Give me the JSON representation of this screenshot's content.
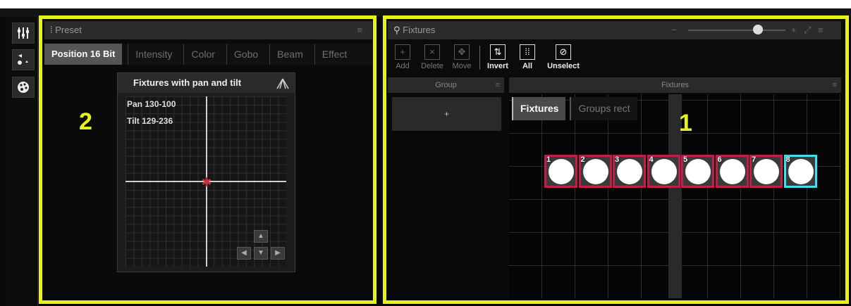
{
  "preset_panel": {
    "title": "Preset",
    "tabs": [
      "Position 16 Bit",
      "Intensity",
      "Color",
      "Gobo",
      "Beam",
      "Effect"
    ],
    "pan_tilt_box": {
      "title": "Fixtures with pan and tilt",
      "pan": "Pan 130-100",
      "tilt": "Tilt 129-236"
    },
    "callout_number": "2"
  },
  "fixtures_panel": {
    "title": "Fixtures",
    "toolbar": [
      {
        "label": "Add",
        "icon": "plus-icon"
      },
      {
        "label": "Delete",
        "icon": "x-icon"
      },
      {
        "label": "Move",
        "icon": "move-icon"
      },
      {
        "label": "Invert",
        "icon": "invert-icon"
      },
      {
        "label": "All",
        "icon": "select-all-icon"
      },
      {
        "label": "Unselect",
        "icon": "unselect-icon"
      }
    ],
    "group_header": "Group",
    "group_add": "+",
    "fixtures_header": "Fixtures",
    "view_tabs": [
      "Fixtures",
      "Groups rect"
    ],
    "fixtures": [
      {
        "num": "1",
        "selected": false
      },
      {
        "num": "2",
        "selected": false
      },
      {
        "num": "3",
        "selected": false
      },
      {
        "num": "4",
        "selected": false
      },
      {
        "num": "5",
        "selected": false
      },
      {
        "num": "6",
        "selected": false
      },
      {
        "num": "7",
        "selected": false
      },
      {
        "num": "8",
        "selected": true
      }
    ],
    "callout_number": "1"
  },
  "colors": {
    "highlight": "#e8f21a",
    "fixture_border": "#c21e4a",
    "fixture_selected": "#3ee0f0"
  }
}
